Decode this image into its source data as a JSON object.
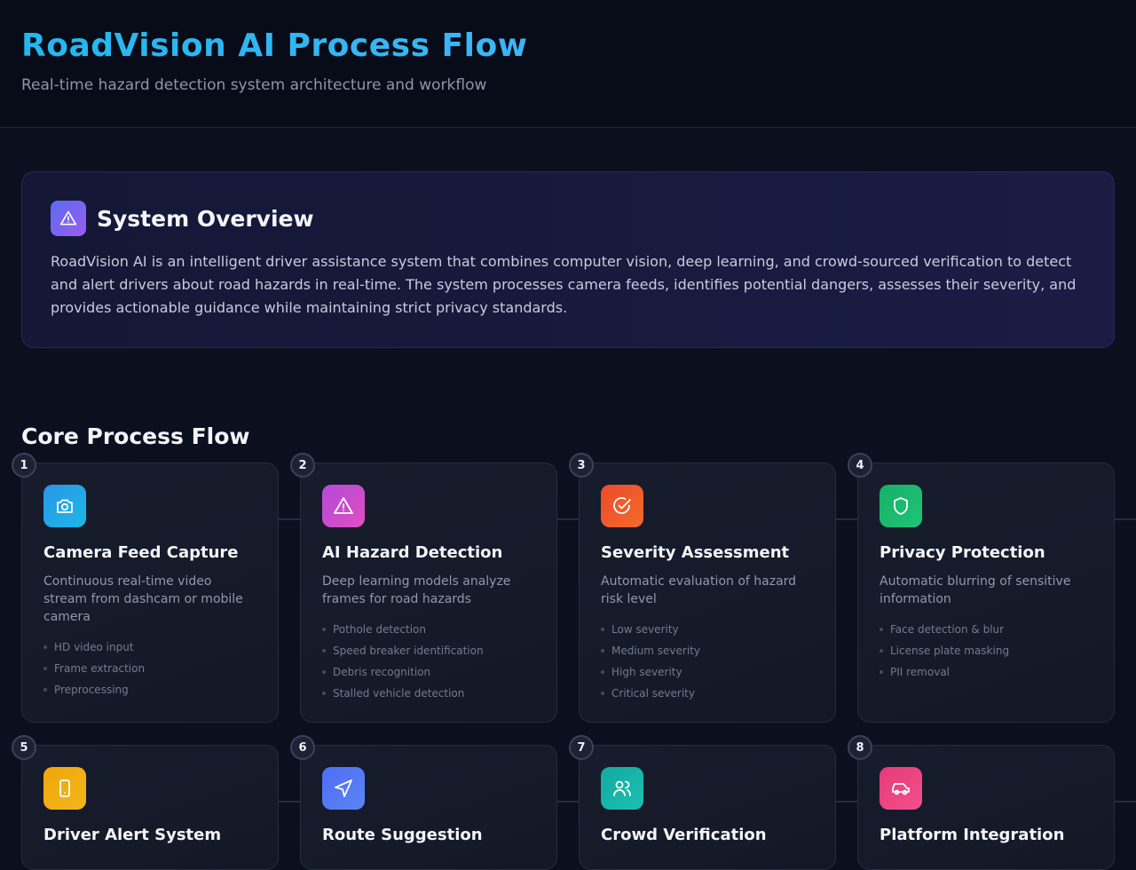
{
  "header": {
    "title": "RoadVision AI Process Flow",
    "subtitle": "Real-time hazard detection system architecture and workflow"
  },
  "overview": {
    "icon": "alert-triangle-icon",
    "title": "System Overview",
    "text": "RoadVision AI is an intelligent driver assistance system that combines computer vision, deep learning, and crowd-sourced verification to detect and alert drivers about road hazards in real-time. The system processes camera feeds, identifies potential dangers, assesses their severity, and provides actionable guidance while maintaining strict privacy standards."
  },
  "process": {
    "title": "Core Process Flow",
    "steps": [
      {
        "number": "1",
        "title": "Camera Feed Capture",
        "description": "Continuous real-time video stream from dashcam or mobile camera",
        "items": [
          "HD video input",
          "Frame extraction",
          "Preprocessing"
        ],
        "icon": "camera-icon",
        "color_from": "#2a95e6",
        "color_to": "#1cb8e8"
      },
      {
        "number": "2",
        "title": "AI Hazard Detection",
        "description": "Deep learning models analyze frames for road hazards",
        "items": [
          "Pothole detection",
          "Speed breaker identification",
          "Debris recognition",
          "Stalled vehicle detection"
        ],
        "icon": "alert-triangle-icon",
        "color_from": "#b34ad8",
        "color_to": "#e04fc0"
      },
      {
        "number": "3",
        "title": "Severity Assessment",
        "description": "Automatic evaluation of hazard risk level",
        "items": [
          "Low severity",
          "Medium severity",
          "High severity",
          "Critical severity"
        ],
        "icon": "check-circle-icon",
        "color_from": "#ec4a2c",
        "color_to": "#f46b2a"
      },
      {
        "number": "4",
        "title": "Privacy Protection",
        "description": "Automatic blurring of sensitive information",
        "items": [
          "Face detection & blur",
          "License plate masking",
          "PII removal"
        ],
        "icon": "shield-icon",
        "color_from": "#18b06a",
        "color_to": "#1fc474"
      },
      {
        "number": "5",
        "title": "Driver Alert System",
        "description": "",
        "items": [],
        "icon": "smartphone-icon",
        "color_from": "#f0a50a",
        "color_to": "#f2b81a"
      },
      {
        "number": "6",
        "title": "Route Suggestion",
        "description": "",
        "items": [],
        "icon": "navigation-icon",
        "color_from": "#4f6ef2",
        "color_to": "#5b84f6"
      },
      {
        "number": "7",
        "title": "Crowd Verification",
        "description": "",
        "items": [],
        "icon": "users-icon",
        "color_from": "#13a9a0",
        "color_to": "#1cc0b2"
      },
      {
        "number": "8",
        "title": "Platform Integration",
        "description": "",
        "items": [],
        "icon": "car-icon",
        "color_from": "#e63a7a",
        "color_to": "#f2508a"
      }
    ]
  }
}
